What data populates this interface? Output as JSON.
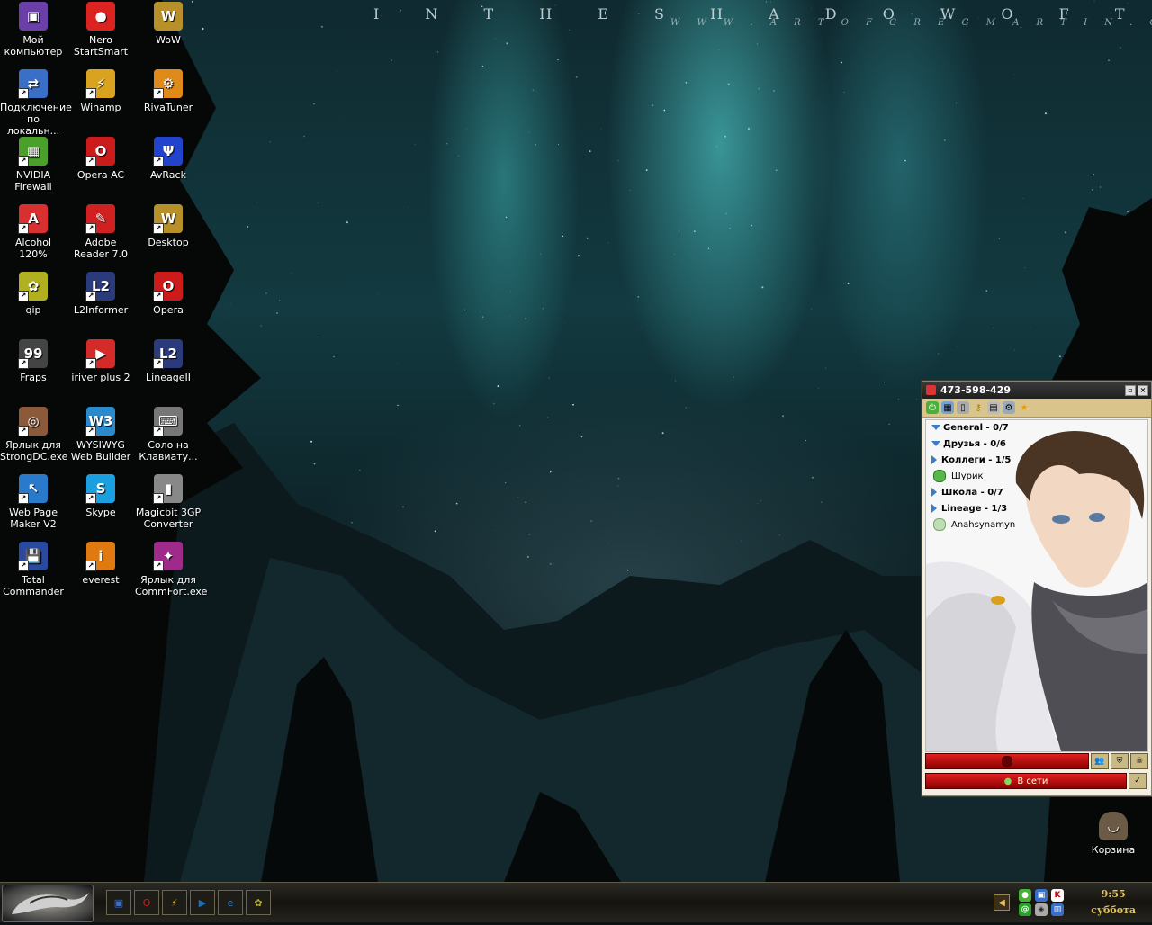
{
  "wallpaper": {
    "title": "I N  T H E  S H A D O W  O F  T H E  S T A R S",
    "subtitle": "W W W . A R T O F G R E G M A R T I N . C O M"
  },
  "desktop_icons": [
    {
      "label": "Мой компьютер",
      "icon": "my-computer-icon",
      "color": "#6b3fa8",
      "glyph": "▣",
      "shortcut": false
    },
    {
      "label": "Nero StartSmart",
      "icon": "nero-icon",
      "color": "#d22",
      "glyph": "●",
      "shortcut": false
    },
    {
      "label": "WoW",
      "icon": "wow-icon",
      "color": "#b8902a",
      "glyph": "W",
      "shortcut": false
    },
    {
      "label": "Подключение по локальн...",
      "icon": "network-connection-icon",
      "color": "#3a6fc8",
      "glyph": "⇄",
      "shortcut": true
    },
    {
      "label": "Winamp",
      "icon": "winamp-icon",
      "color": "#d9a320",
      "glyph": "⚡",
      "shortcut": true
    },
    {
      "label": "RivaTuner",
      "icon": "rivatuner-icon",
      "color": "#e08a1a",
      "glyph": "⚙",
      "shortcut": true
    },
    {
      "label": "NVIDIA Firewall",
      "icon": "nvidia-firewall-icon",
      "color": "#4aa02a",
      "glyph": "▦",
      "shortcut": true
    },
    {
      "label": "Opera AC",
      "icon": "opera-ac-icon",
      "color": "#cc1b1b",
      "glyph": "O",
      "shortcut": true
    },
    {
      "label": "AvRack",
      "icon": "avrack-icon",
      "color": "#2244cc",
      "glyph": "Ψ",
      "shortcut": true
    },
    {
      "label": "Alcohol 120%",
      "icon": "alcohol-icon",
      "color": "#d83030",
      "glyph": "A",
      "shortcut": true
    },
    {
      "label": "Adobe Reader 7.0",
      "icon": "adobe-reader-icon",
      "color": "#d02020",
      "glyph": "✎",
      "shortcut": true
    },
    {
      "label": "Desktop",
      "icon": "wow-desktop-icon",
      "color": "#b8902a",
      "glyph": "W",
      "shortcut": true
    },
    {
      "label": "qip",
      "icon": "qip-icon",
      "color": "#b0b020",
      "glyph": "✿",
      "shortcut": true
    },
    {
      "label": "L2Informer",
      "icon": "l2informer-icon",
      "color": "#2a3a7a",
      "glyph": "L2",
      "shortcut": true
    },
    {
      "label": "Opera",
      "icon": "opera-icon",
      "color": "#cc1b1b",
      "glyph": "O",
      "shortcut": true
    },
    {
      "label": "Fraps",
      "icon": "fraps-icon",
      "color": "#444",
      "glyph": "99",
      "shortcut": true
    },
    {
      "label": "iriver plus 2",
      "icon": "iriver-icon",
      "color": "#d42a2a",
      "glyph": "▶",
      "shortcut": true
    },
    {
      "label": "LineageII",
      "icon": "lineage2-icon",
      "color": "#2a3a7a",
      "glyph": "L2",
      "shortcut": true
    },
    {
      "label": "Ярлык для StrongDC.exe",
      "icon": "strongdc-icon",
      "color": "#8a5a3a",
      "glyph": "◎",
      "shortcut": true
    },
    {
      "label": "WYSIWYG Web Builder",
      "icon": "wysiwyg-icon",
      "color": "#2a8acc",
      "glyph": "W3",
      "shortcut": true
    },
    {
      "label": "Соло на Клавиату...",
      "icon": "solo-keyboard-icon",
      "color": "#777",
      "glyph": "⌨",
      "shortcut": true
    },
    {
      "label": "Web Page Maker V2",
      "icon": "webpage-maker-icon",
      "color": "#2a7acc",
      "glyph": "↖",
      "shortcut": true
    },
    {
      "label": "Skype",
      "icon": "skype-icon",
      "color": "#1aa0e0",
      "glyph": "S",
      "shortcut": true
    },
    {
      "label": "Magicbit 3GP Converter",
      "icon": "magicbit-icon",
      "color": "#888",
      "glyph": "▮",
      "shortcut": true
    },
    {
      "label": "Total Commander",
      "icon": "total-commander-icon",
      "color": "#2a4aa0",
      "glyph": "💾",
      "shortcut": true
    },
    {
      "label": "everest",
      "icon": "everest-icon",
      "color": "#e07a10",
      "glyph": "i",
      "shortcut": true
    },
    {
      "label": "Ярлык для CommFort.exe",
      "icon": "commfort-icon",
      "color": "#a02a8a",
      "glyph": "✦",
      "shortcut": true
    }
  ],
  "recycle_bin": {
    "label": "Корзина",
    "icon": "recycle-bin-icon"
  },
  "qip": {
    "title": "473-598-429",
    "groups": [
      {
        "label": "General - 0/7",
        "open": true,
        "contacts": []
      },
      {
        "label": "Друзья - 0/6",
        "open": true,
        "contacts": []
      },
      {
        "label": "Коллеги - 1/5",
        "open": false,
        "contacts": [
          {
            "name": "Шурик",
            "status": "online"
          }
        ]
      },
      {
        "label": "Школа - 0/7",
        "open": false,
        "contacts": []
      },
      {
        "label": "Lineage - 1/3",
        "open": false,
        "contacts": [
          {
            "name": "Anahsynamyn",
            "status": "away"
          }
        ]
      }
    ],
    "status_label": "В сети",
    "accent": "#d9c58b"
  },
  "taskbar": {
    "quicklaunch": [
      "show-desktop-icon",
      "opera-icon",
      "winamp-icon",
      "media-player-icon",
      "internet-explorer-icon",
      "qip-icon"
    ],
    "clock_time": "9:55",
    "clock_day": "суббота"
  }
}
